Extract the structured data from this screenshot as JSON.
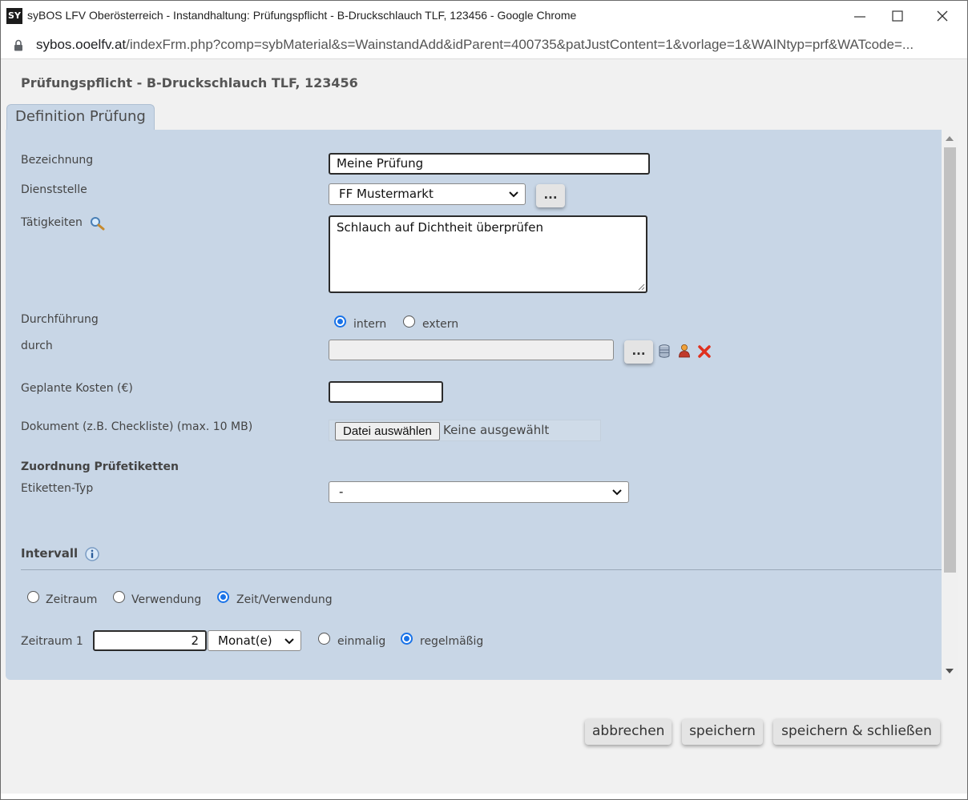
{
  "window": {
    "title": "syBOS LFV Oberösterreich - Instandhaltung: Prüfungspflicht - B-Druckschlauch TLF, 123456 - Google Chrome",
    "app_icon_text": "SY",
    "url_host": "sybos.ooelfv.at",
    "url_path": "/indexFrm.php?comp=sybMaterial&s=WainstandAdd&idParent=400735&patJustContent=1&vorlage=1&WAINtyp=prf&WATcode=..."
  },
  "page": {
    "title": "Prüfungspflicht - B-Druckschlauch TLF, 123456",
    "tab_label": "Definition Prüfung"
  },
  "form": {
    "bezeichnung": {
      "label": "Bezeichnung",
      "value": "Meine Prüfung"
    },
    "dienststelle": {
      "label": "Dienststelle",
      "value": "FF Mustermarkt",
      "more_label": "..."
    },
    "taetigkeiten": {
      "label": "Tätigkeiten",
      "value": "Schlauch auf Dichtheit überprüfen"
    },
    "durchfuehrung": {
      "label": "Durchführung",
      "options": [
        "intern",
        "extern"
      ],
      "selected": "intern"
    },
    "durch": {
      "label": "durch",
      "value": "",
      "more_label": "..."
    },
    "kosten": {
      "label": "Geplante Kosten (€)",
      "value": ""
    },
    "dokument": {
      "label": "Dokument (z.B. Checkliste) (max. 10 MB)",
      "button_label": "Datei auswählen",
      "status": "Keine ausgewählt"
    },
    "zuordnung": {
      "heading": "Zuordnung Prüfetiketten",
      "etiketten_label": "Etiketten-Typ",
      "etiketten_value": "-"
    },
    "intervall": {
      "heading": "Intervall",
      "modes": [
        "Zeitraum",
        "Verwendung",
        "Zeit/Verwendung"
      ],
      "selected_mode": "Zeit/Verwendung",
      "zeitraum1_label": "Zeitraum 1",
      "zeitraum1_value": "2",
      "zeitraum1_unit": "Monat(e)",
      "frequency_options": [
        "einmalig",
        "regelmäßig"
      ],
      "selected_frequency": "regelmäßig"
    }
  },
  "actions": {
    "cancel": "abbrechen",
    "save": "speichern",
    "save_close": "speichern & schließen"
  },
  "colors": {
    "panel_bg": "#c8d6e6",
    "accent": "#1a73e8"
  }
}
